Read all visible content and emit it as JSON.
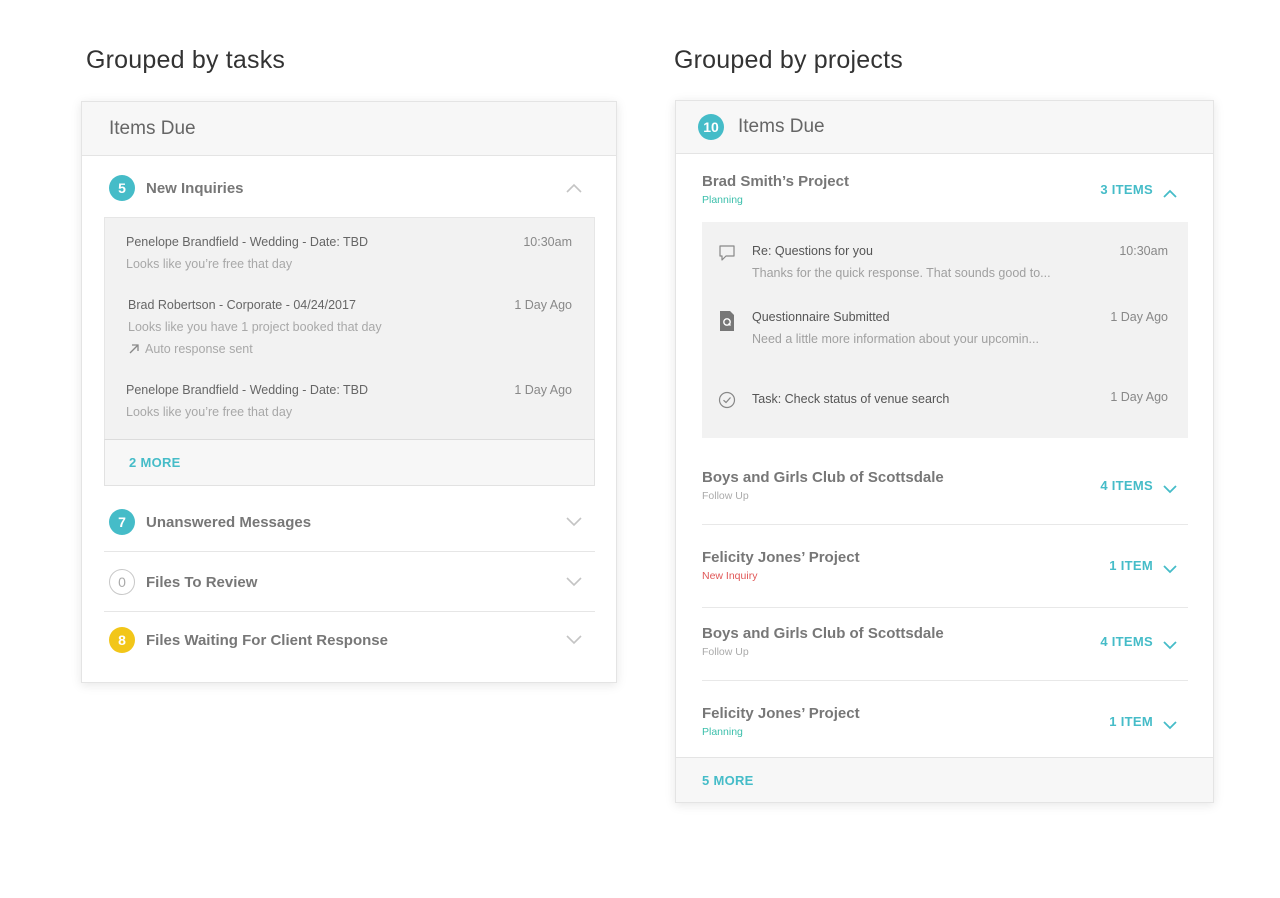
{
  "left": {
    "heading": "Grouped by tasks",
    "header_title": "Items Due",
    "sections": [
      {
        "count": "5",
        "label": "New Inquiries",
        "badge_color": "#45bcc8",
        "expanded": true
      },
      {
        "count": "7",
        "label": "Unanswered Messages",
        "badge_color": "#45bcc8",
        "expanded": false
      },
      {
        "count": "0",
        "label": "Files To Review",
        "badge_color": "outline",
        "expanded": false
      },
      {
        "count": "8",
        "label": "Files Waiting For Client Response",
        "badge_color": "#f2c619",
        "expanded": false
      }
    ],
    "inquiries": [
      {
        "title": "Penelope Brandfield - Wedding - Date: TBD",
        "subtitle": "Looks like you’re free that day",
        "time": "10:30am"
      },
      {
        "title": "Brad Robertson - Corporate - 04/24/2017",
        "subtitle": "Looks like you have 1 project booked that day",
        "note": "Auto response sent",
        "note_icon": "arrow-up-right-icon",
        "time": "1 Day Ago"
      },
      {
        "title": "Penelope Brandfield - Wedding - Date: TBD",
        "subtitle": "Looks like you’re free that day",
        "time": "1 Day Ago"
      }
    ],
    "more_label": "2 MORE"
  },
  "right": {
    "heading": "Grouped by projects",
    "header_count": "10",
    "header_title": "Items Due",
    "projects": [
      {
        "name": "Brad Smith’s Project",
        "status": "Planning",
        "count_label": "3 ITEMS",
        "expanded": true
      },
      {
        "name": "Boys and Girls Club of Scottsdale",
        "status": "Follow Up",
        "count_label": "4 ITEMS",
        "expanded": false
      },
      {
        "name": "Felicity Jones’ Project",
        "status": "New Inquiry",
        "count_label": "1 ITEM",
        "expanded": false
      },
      {
        "name": "Boys and Girls Club of Scottsdale",
        "status": "Follow Up",
        "count_label": "4 ITEMS",
        "expanded": false
      },
      {
        "name": "Felicity Jones’ Project",
        "status": "Planning",
        "count_label": "1 ITEM",
        "expanded": false
      }
    ],
    "items": [
      {
        "icon": "chat-bubble-icon",
        "title": "Re: Questions for you",
        "subtitle": "Thanks for the quick response. That sounds good to...",
        "time": "10:30am"
      },
      {
        "icon": "questionnaire-file-icon",
        "title": "Questionnaire Submitted",
        "subtitle": "Need a little more information about your upcomin...",
        "time": "1 Day Ago"
      },
      {
        "icon": "check-circle-icon",
        "title": "Task: Check status of venue search",
        "subtitle": "",
        "time": "1 Day Ago"
      }
    ],
    "more_label": "5 MORE"
  },
  "colors": {
    "accent": "#45bcc8",
    "yellow": "#f2c619",
    "planning": "#3bbfab",
    "new_inquiry": "#e05757"
  }
}
